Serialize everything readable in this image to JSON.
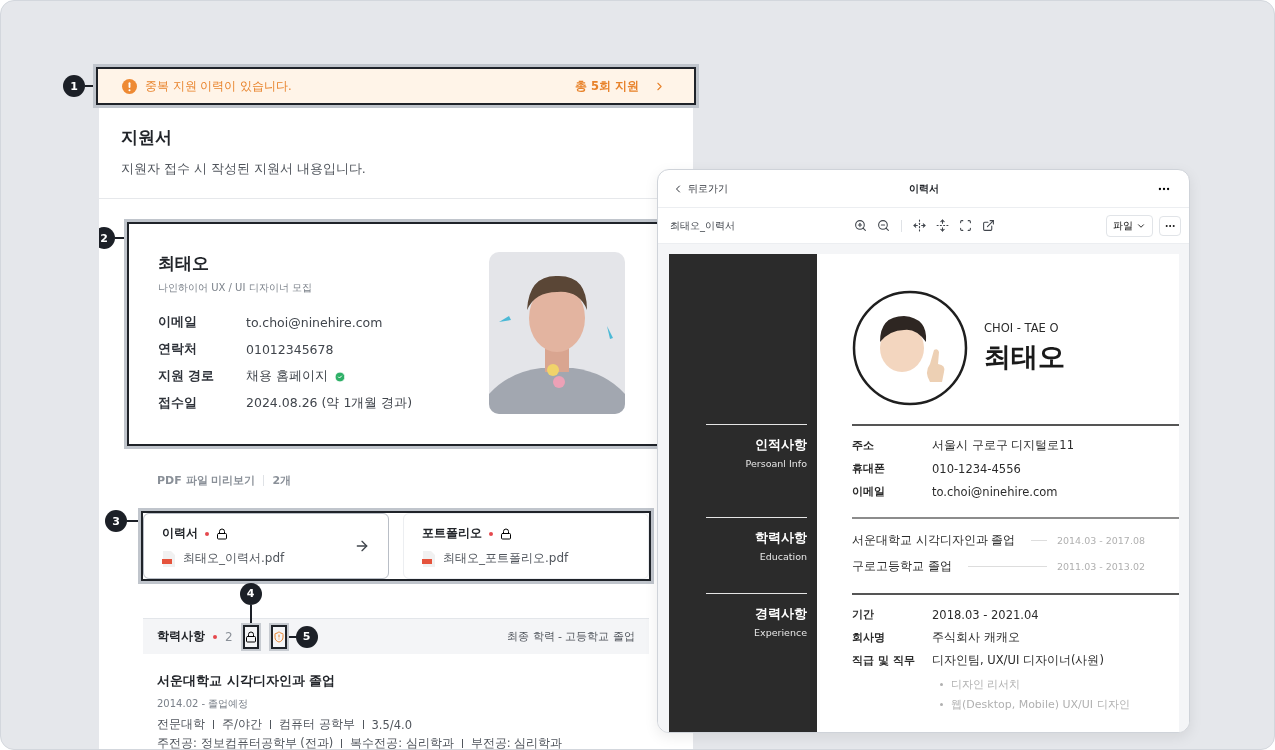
{
  "alert": {
    "message": "중복 지원 이력이 있습니다.",
    "count_label": "총 5회 지원"
  },
  "header": {
    "title": "지원서",
    "subtitle": "지원자 접수 시 작성된 지원서 내용입니다."
  },
  "profile": {
    "name": "최태오",
    "posting": "나인하이어 UX / UI 디자이너 모집",
    "fields": [
      {
        "label": "이메일",
        "value": "to.choi@ninehire.com",
        "verified": false
      },
      {
        "label": "연락처",
        "value": "01012345678",
        "verified": false
      },
      {
        "label": "지원 경로",
        "value": "채용 홈페이지",
        "verified": true
      },
      {
        "label": "접수일",
        "value": "2024.08.26 (약 1개월 경과)",
        "verified": false
      }
    ]
  },
  "pdf": {
    "label": "PDF 파일 미리보기",
    "count": "2개"
  },
  "files": [
    {
      "title": "이력서",
      "filename": "최태오_이력서.pdf",
      "required": true,
      "locked": true,
      "selected": true
    },
    {
      "title": "포트폴리오",
      "filename": "최태오_포트폴리오.pdf",
      "required": true,
      "locked": true,
      "selected": false
    }
  ],
  "education": {
    "title": "학력사항",
    "count": "2",
    "summary": "최종 학력 - 고등학교 졸업",
    "locked": true,
    "warning": true,
    "items": [
      {
        "school": "서운대학교 시각디자인과 졸업",
        "period": "2014.02 - 졸업예정",
        "details": [
          "전문대학",
          "주/야간",
          "컴퓨터 공학부",
          "3.5/4.0"
        ],
        "majors": [
          "주전공: 정보컴퓨터공학부 (전과)",
          "복수전공: 심리학과",
          "부전공: 심리학과"
        ]
      }
    ]
  },
  "callouts": [
    "1",
    "2",
    "3",
    "4",
    "5"
  ],
  "viewer": {
    "back": "뒤로가기",
    "title": "이력서",
    "filename": "최태오_이력서",
    "file_menu": "파일",
    "resume": {
      "name_en": "CHOI - TAE O",
      "name": "최태오",
      "sections": [
        {
          "kind": "fields",
          "title": "인적사항",
          "subtitle": "Persoanl Info",
          "rows": [
            {
              "label": "주소",
              "value": "서울시 구로구 디지털로11"
            },
            {
              "label": "휴대폰",
              "value": "010-1234-4556"
            },
            {
              "label": "이메일",
              "value": "to.choi@ninehire.com"
            }
          ]
        },
        {
          "kind": "timeline",
          "title": "학력사항",
          "subtitle": "Education",
          "rows": [
            {
              "label": "서운대학교 시각디자인과 졸업",
              "value": "2014.03 - 2017.08"
            },
            {
              "label": "구로고등학교 졸업",
              "value": "2011.03 - 2013.02"
            }
          ]
        },
        {
          "kind": "fields",
          "title": "경력사항",
          "subtitle": "Experience",
          "rows": [
            {
              "label": "기간",
              "value": "2018.03 - 2021.04"
            },
            {
              "label": "회사명",
              "value": "주식회사 캐캐오"
            },
            {
              "label": "직급 및 직무",
              "value": "디자인팀, UX/UI 디자이너(사원)"
            }
          ],
          "bullets": [
            "디자인 리서치",
            "웹(Desktop, Mobile) UX/UI 디자인"
          ]
        }
      ]
    }
  }
}
